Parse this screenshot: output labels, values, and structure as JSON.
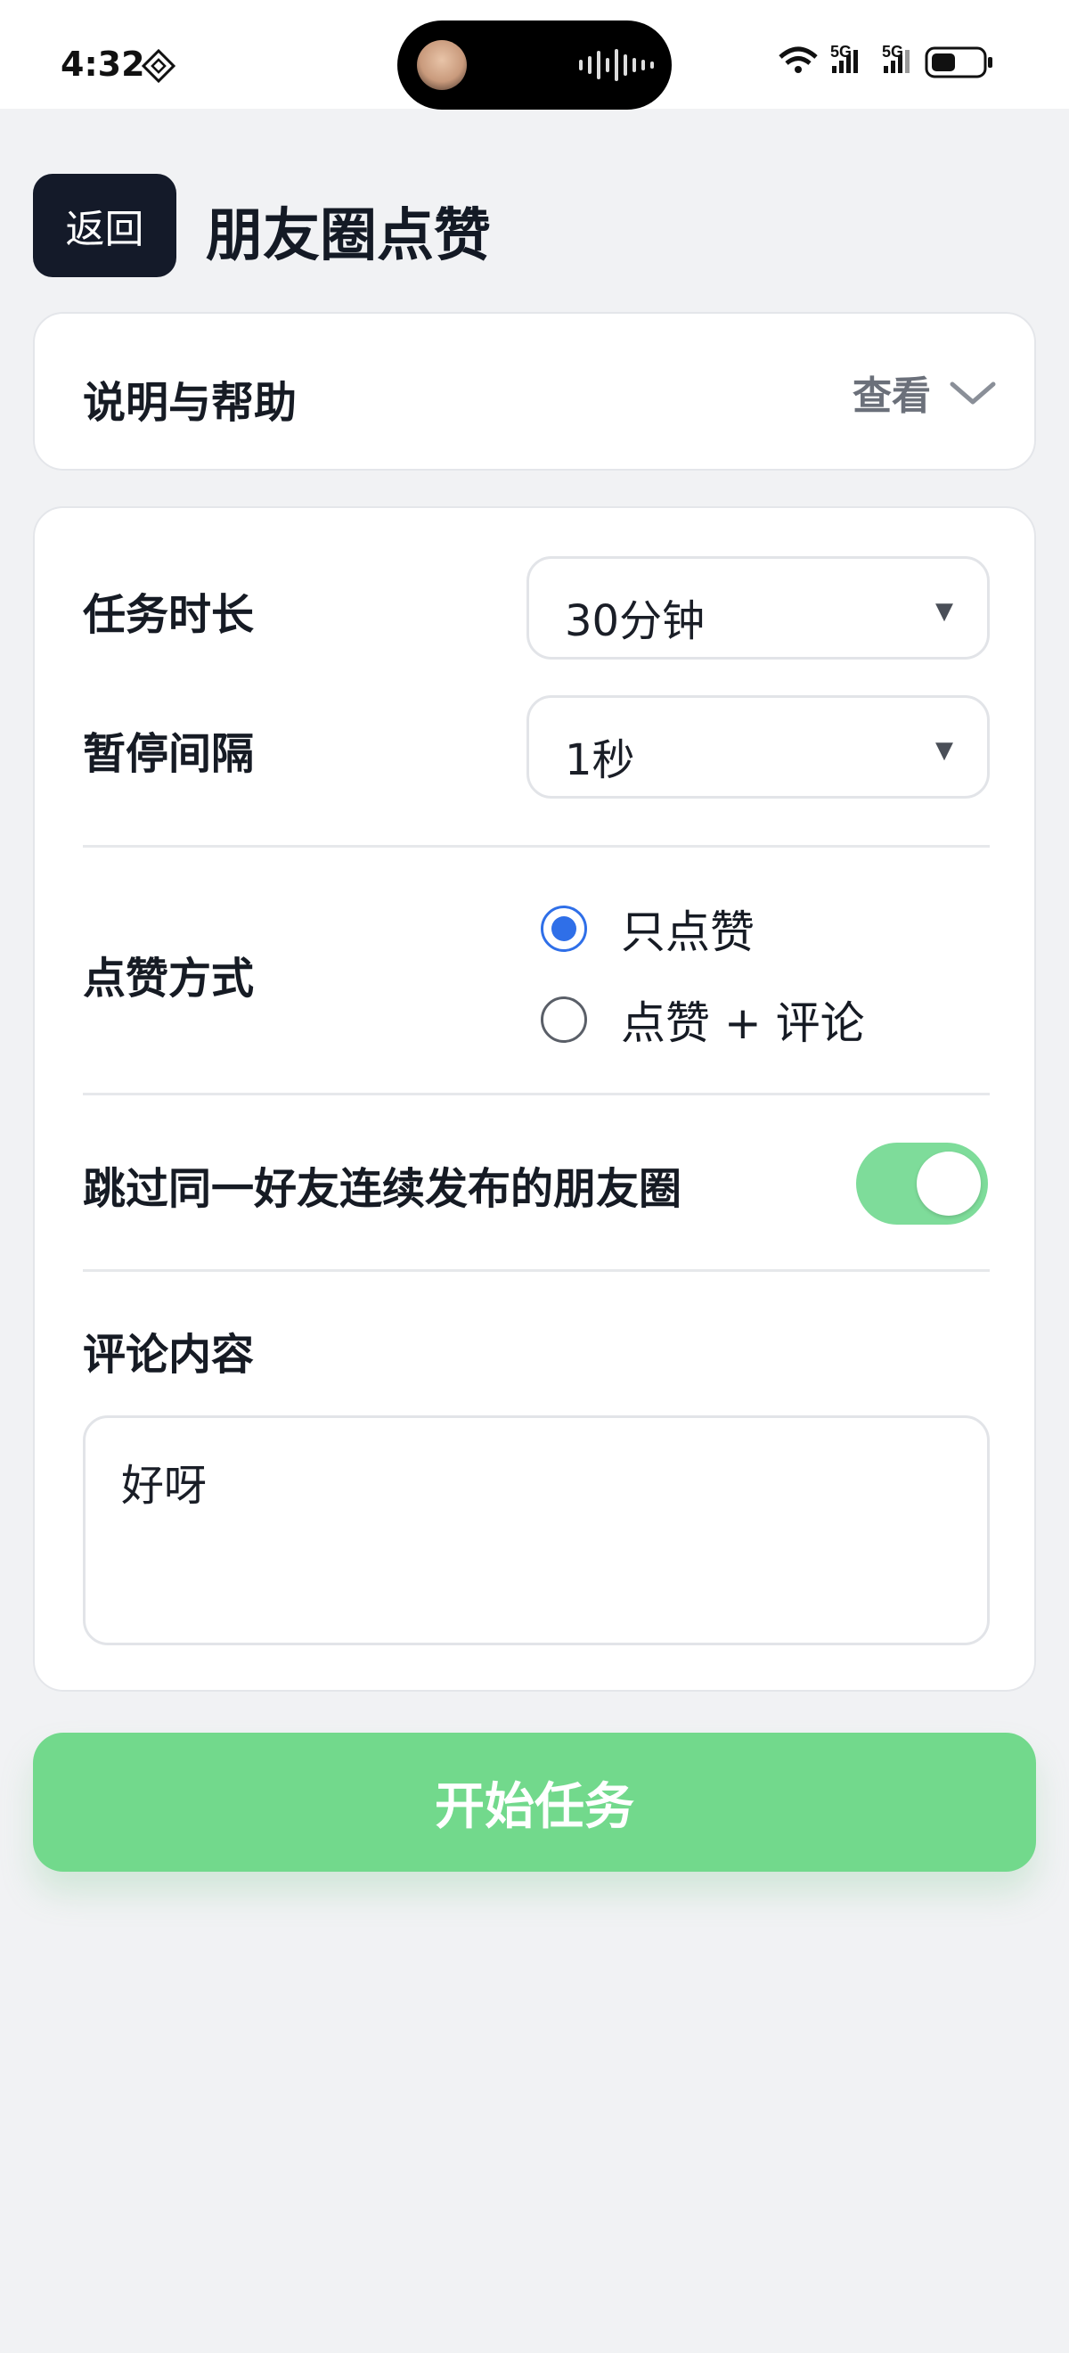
{
  "status_bar": {
    "time": "4:32",
    "network_a": "5G",
    "network_b": "5G"
  },
  "header": {
    "back_label": "返回",
    "title": "朋友圈点赞"
  },
  "help": {
    "title": "说明与帮助",
    "action_label": "查看"
  },
  "settings": {
    "duration": {
      "label": "任务时长",
      "value": "30分钟"
    },
    "interval": {
      "label": "暂停间隔",
      "value": "1秒"
    },
    "like_mode": {
      "label": "点赞方式",
      "options": [
        {
          "label": "只点赞",
          "selected": true
        },
        {
          "label": "点赞 + 评论",
          "selected": false
        }
      ]
    },
    "skip_consecutive": {
      "label": "跳过同一好友连续发布的朋友圈",
      "enabled": true
    },
    "comment": {
      "label": "评论内容",
      "value": "好呀"
    }
  },
  "start_button_label": "开始任务",
  "colors": {
    "accent_green": "#72d98c",
    "radio_blue": "#2f6fe8",
    "back_button": "#141a29",
    "background": "#f1f2f4"
  }
}
